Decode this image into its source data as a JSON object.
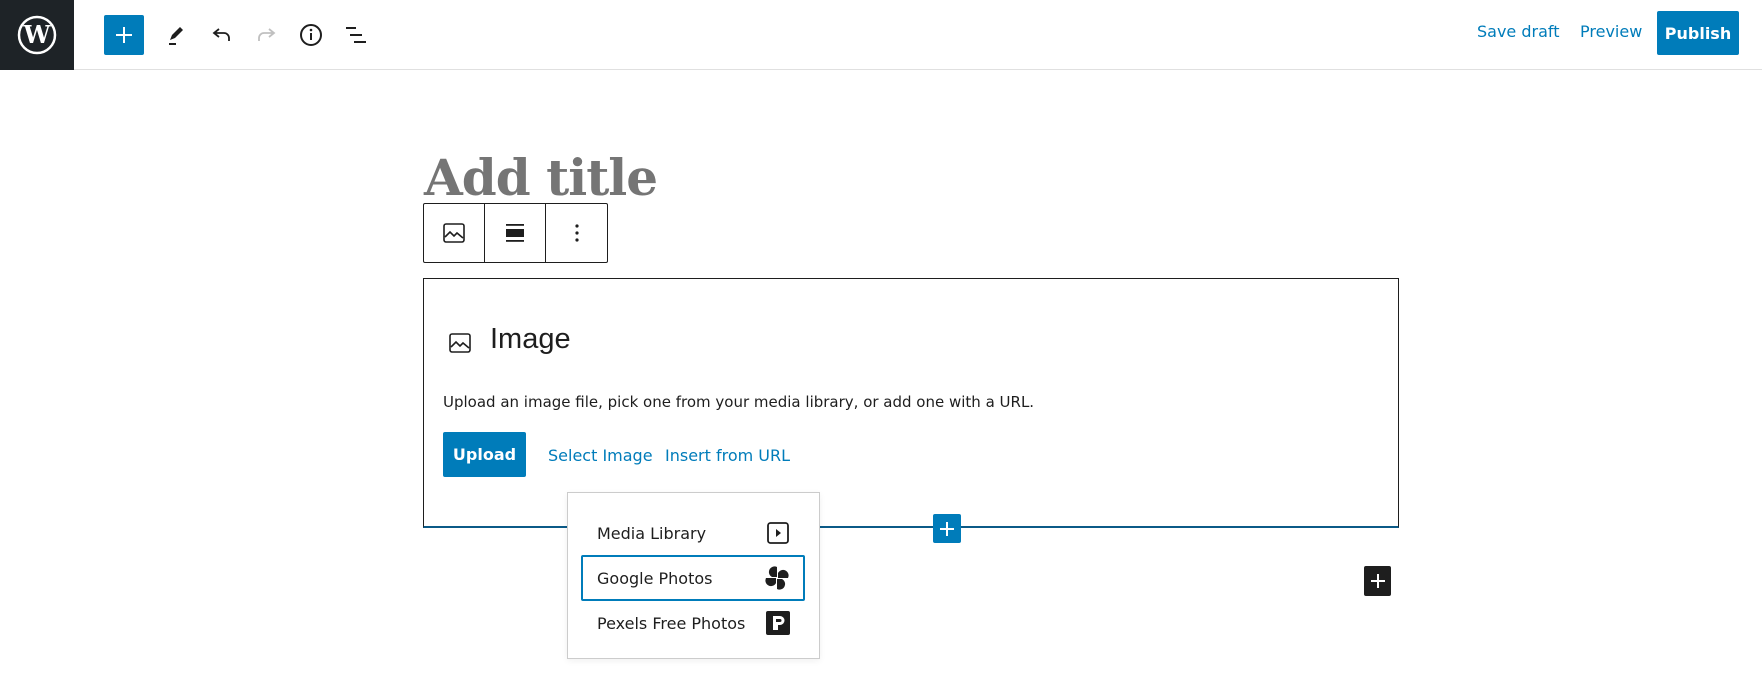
{
  "header": {
    "logo": "wordpress-logo",
    "toolbar": [
      {
        "name": "add-block",
        "icon": "plus-icon",
        "label": "Add block"
      },
      {
        "name": "tools",
        "icon": "pencil-icon",
        "label": "Tools"
      },
      {
        "name": "undo",
        "icon": "undo-icon",
        "label": "Undo"
      },
      {
        "name": "redo",
        "icon": "redo-icon",
        "label": "Redo",
        "disabled": true
      },
      {
        "name": "details",
        "icon": "info-icon",
        "label": "Details"
      },
      {
        "name": "list-view",
        "icon": "list-view-icon",
        "label": "List View"
      }
    ],
    "save_draft": "Save draft",
    "preview": "Preview",
    "publish": "Publish"
  },
  "editor": {
    "title_placeholder": "Add title",
    "block_toolbar": [
      {
        "name": "image-block-type",
        "icon": "image-icon"
      },
      {
        "name": "align",
        "icon": "align-icon"
      },
      {
        "name": "options",
        "icon": "more-vertical-icon"
      }
    ],
    "image_block": {
      "icon": "image-icon",
      "label": "Image",
      "instructions": "Upload an image file, pick one from your media library, or add one with a URL.",
      "upload": "Upload",
      "select_image": "Select Image",
      "insert_from_url": "Insert from URL"
    },
    "media_menu": {
      "items": [
        {
          "label": "Media Library",
          "icon": "media-library-icon",
          "focused": false
        },
        {
          "label": "Google Photos",
          "icon": "google-photos-icon",
          "focused": true
        },
        {
          "label": "Pexels Free Photos",
          "icon": "pexels-icon",
          "focused": false
        }
      ]
    }
  },
  "colors": {
    "accent": "#007cba",
    "dark": "#1e1e1e",
    "logo_bg": "#1e2327",
    "placeholder": "#757575"
  }
}
